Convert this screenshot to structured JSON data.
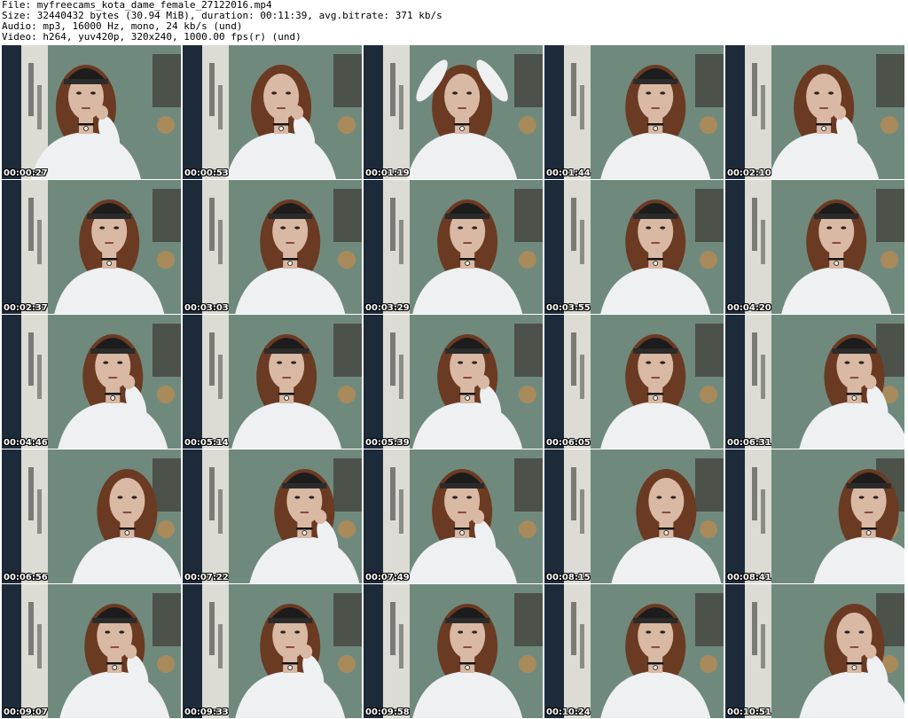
{
  "header": {
    "file_line": "File: myfreecams_kota_dame_female_27122016.mp4",
    "size_line": "Size: 32440432 bytes (30.94 MiB), duration: 00:11:39, avg.bitrate: 371 kb/s",
    "audio_line": "Audio: mp3, 16000 Hz, mono, 24 kb/s (und)",
    "video_line": "Video: h264, yuv420p, 320x240, 1000.00 fps(r) (und)"
  },
  "thumbnails": [
    {
      "time": "00:00:27"
    },
    {
      "time": "00:00:53"
    },
    {
      "time": "00:01:19"
    },
    {
      "time": "00:01:44"
    },
    {
      "time": "00:02:10"
    },
    {
      "time": "00:02:37"
    },
    {
      "time": "00:03:03"
    },
    {
      "time": "00:03:29"
    },
    {
      "time": "00:03:55"
    },
    {
      "time": "00:04:20"
    },
    {
      "time": "00:04:46"
    },
    {
      "time": "00:05:14"
    },
    {
      "time": "00:05:39"
    },
    {
      "time": "00:06:05"
    },
    {
      "time": "00:06:31"
    },
    {
      "time": "00:06:56"
    },
    {
      "time": "00:07:22"
    },
    {
      "time": "00:07:49"
    },
    {
      "time": "00:08:15"
    },
    {
      "time": "00:08:41"
    },
    {
      "time": "00:09:07"
    },
    {
      "time": "00:09:33"
    },
    {
      "time": "00:09:58"
    },
    {
      "time": "00:10:24"
    },
    {
      "time": "00:10:51"
    }
  ],
  "colors": {
    "wall": "#6f8a7d",
    "curtain": "#1d2a3a",
    "poster": "#e8e4de",
    "hair": "#6b3a22",
    "shirt": "#eef0f2",
    "skin": "#d9b9a3",
    "cap": "#1c1c1c",
    "timestamp_text": "#ffffff"
  }
}
